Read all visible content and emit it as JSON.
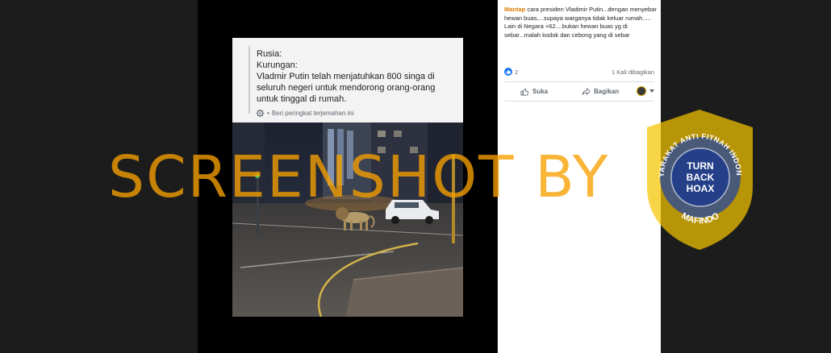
{
  "post": {
    "lines": [
      "Rusia:",
      "Kurungan:",
      "Vladmir Putin telah menjatuhkan 800 singa di seluruh negeri untuk mendorong orang-orang untuk tinggal di rumah."
    ],
    "rate_translation": "Beri peringkat terjemahan ini"
  },
  "caption": {
    "user": "Mantap",
    "text1": " cara presiden Vladimir Putin...dengan menyebar hewan buas,...supaya warganya tidak keluar rumah.....",
    "text2": "Lain di Negara +62....bukan hewan buas yg di sebar...malah kodok dan cebong yang di sebar"
  },
  "reactions": {
    "count": "2",
    "shares": "1 Kali dibagikan"
  },
  "actions": {
    "like": "Suka",
    "share": "Bagikan"
  },
  "watermark": {
    "text": "SCREENSHOT BY"
  },
  "logo": {
    "top_text": "MASYARAKAT ANTI FITNAH INDONESIA",
    "l1": "TURN",
    "l2": "BACK",
    "l3": "HOAX",
    "bottom": "MAFINDO"
  },
  "colors": {
    "facebook_blue": "#1877f2",
    "watermark_orange": "#f7a000",
    "mafindo_blue": "#2a4a9a",
    "mafindo_yellow": "#f5c400"
  }
}
